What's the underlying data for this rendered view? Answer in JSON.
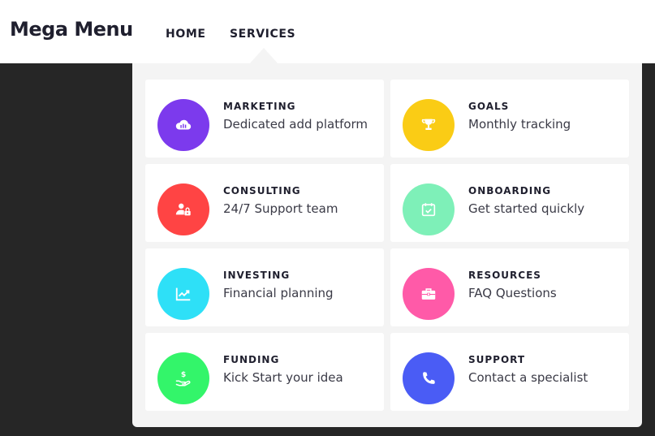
{
  "brand": "Mega Menu",
  "nav": {
    "home": "HOME",
    "services": "SERVICES"
  },
  "menu": [
    {
      "title": "MARKETING",
      "desc": "Dedicated add platform",
      "color": "#7c3aed",
      "icon": "cloud-chart-icon"
    },
    {
      "title": "GOALS",
      "desc": "Monthly tracking",
      "color": "#facc15",
      "icon": "trophy-icon"
    },
    {
      "title": "CONSULTING",
      "desc": "24/7 Support team",
      "color": "#ff4444",
      "icon": "user-lock-icon"
    },
    {
      "title": "ONBOARDING",
      "desc": "Get started quickly",
      "color": "#7ef0b8",
      "icon": "calendar-check-icon"
    },
    {
      "title": "INVESTING",
      "desc": "Financial planning",
      "color": "#2ee0f7",
      "icon": "chart-line-icon"
    },
    {
      "title": "RESOURCES",
      "desc": "FAQ Questions",
      "color": "#ff5aa8",
      "icon": "briefcase-icon"
    },
    {
      "title": "FUNDING",
      "desc": "Kick Start your idea",
      "color": "#33f56a",
      "icon": "hand-dollar-icon"
    },
    {
      "title": "SUPPORT",
      "desc": "Contact a specialist",
      "color": "#4a5cf5",
      "icon": "phone-icon"
    }
  ]
}
